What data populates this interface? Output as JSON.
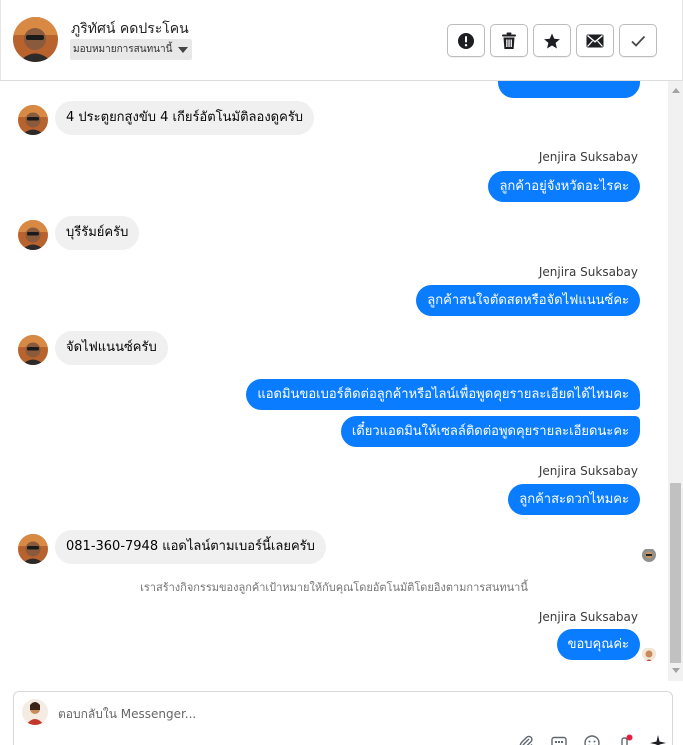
{
  "header": {
    "contact_name": "ภูริทัศน์ คดประโคน",
    "assign_label": "มอบหมายการสนทนานี้",
    "actions": [
      {
        "name": "mark-spam-button",
        "icon": "exclamation-circle-icon"
      },
      {
        "name": "delete-button",
        "icon": "trash-icon"
      },
      {
        "name": "star-button",
        "icon": "star-icon"
      },
      {
        "name": "mark-unread-button",
        "icon": "envelope-icon"
      },
      {
        "name": "mark-done-button",
        "icon": "check-icon"
      }
    ]
  },
  "messages": [
    {
      "type": "out",
      "text": ""
    },
    {
      "type": "in",
      "text": "4 ประตูยกสูงขับ 4 เกียร์อัตโนมัติลองดูครับ"
    },
    {
      "type": "out",
      "sender": "Jenjira Suksabay",
      "text": "ลูกค้าอยู่จังหวัดอะไรคะ"
    },
    {
      "type": "in",
      "text": "บุรีรัมย์ครับ"
    },
    {
      "type": "out",
      "sender": "Jenjira Suksabay",
      "text": "ลูกค้าสนใจตัดสดหรือจัดไฟแนนซ์คะ"
    },
    {
      "type": "in",
      "text": "จัดไฟแนนซ์ครับ"
    },
    {
      "type": "out",
      "text": "แอดมินขอเบอร์ติดต่อลูกค้าหรือไลน์เพื่อพูดคุยรายละเอียดได้ไหมคะ"
    },
    {
      "type": "out",
      "text": "เดี๋ยวแอดมินให้เซลล์ติดต่อพูดคุยรายละเอียดนะคะ"
    },
    {
      "type": "out",
      "sender": "Jenjira Suksabay",
      "text": "ลูกค้าสะดวกไหมคะ"
    },
    {
      "type": "in",
      "text": "081-360-7948 แอดไลน์ตามเบอร์นี้เลยครับ"
    },
    {
      "type": "system",
      "text": "เราสร้างกิจกรรมของลูกค้าเป้าหมายให้กับคุณโดยอัตโนมัติโดยอิงตามการสนทนานี้"
    },
    {
      "type": "out",
      "sender": "Jenjira Suksabay",
      "text": "ขอบคุณค่ะ"
    }
  ],
  "composer": {
    "placeholder": "ตอบกลับใน Messenger...",
    "tools": [
      "attachment-icon",
      "saved-replies-icon",
      "emoji-icon",
      "notification-icon",
      "magic-icon"
    ]
  },
  "colors": {
    "outgoing_bubble": "#0a7cff",
    "incoming_bubble": "#f0f0f0",
    "notification_dot": "#e41e3f"
  }
}
